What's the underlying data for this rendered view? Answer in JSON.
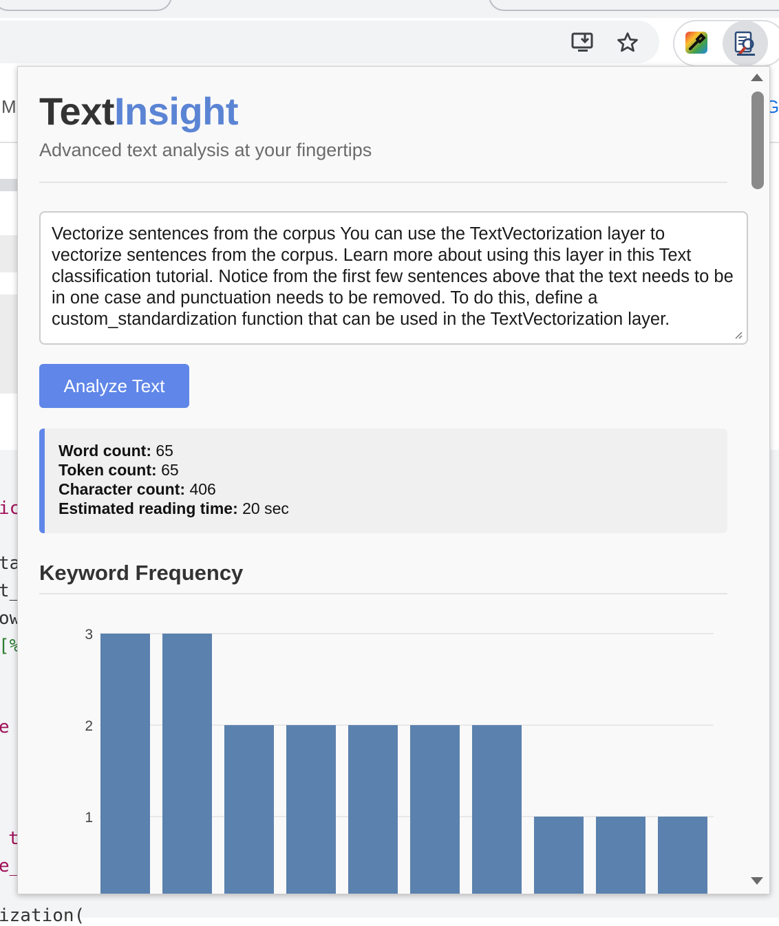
{
  "popup": {
    "title_main": "Text",
    "title_accent": "Insight",
    "subtitle": "Advanced text analysis at your fingertips",
    "input_text": "Vectorize sentences from the corpus You can use the TextVectorization layer to vectorize sentences from the corpus. Learn more about using this layer in this Text classification tutorial. Notice from the first few sentences above that the text needs to be in one case and punctuation needs to be removed. To do this, define a custom_standardization function that can be used in the TextVectorization layer.",
    "analyze_button": "Analyze Text",
    "stats": [
      {
        "label": "Word count:",
        "value": "65"
      },
      {
        "label": "Token count:",
        "value": "65"
      },
      {
        "label": "Character count:",
        "value": "406"
      },
      {
        "label": "Estimated reading time:",
        "value": "20 sec"
      }
    ],
    "keyword_heading": "Keyword Frequency"
  },
  "chart_data": {
    "type": "bar",
    "values": [
      3,
      3,
      2,
      2,
      2,
      2,
      2,
      1,
      1,
      1
    ],
    "yticks": [
      "1",
      "2",
      "3"
    ],
    "bar_color": "#5b81ae",
    "grid": true
  },
  "colors": {
    "accent": "#5b84d4",
    "button": "#5f86e8",
    "bar": "#5b81ae"
  },
  "toolbar": {
    "icons": [
      "install-app-icon",
      "bookmark-star-icon",
      "color-picker-extension-icon",
      "textinsight-extension-icon"
    ]
  },
  "background_page": {
    "fragments": [
      "M",
      "G",
      "ic",
      "ta",
      "t_",
      "ow",
      "[%",
      "e",
      "t",
      "e_",
      "ization("
    ]
  }
}
